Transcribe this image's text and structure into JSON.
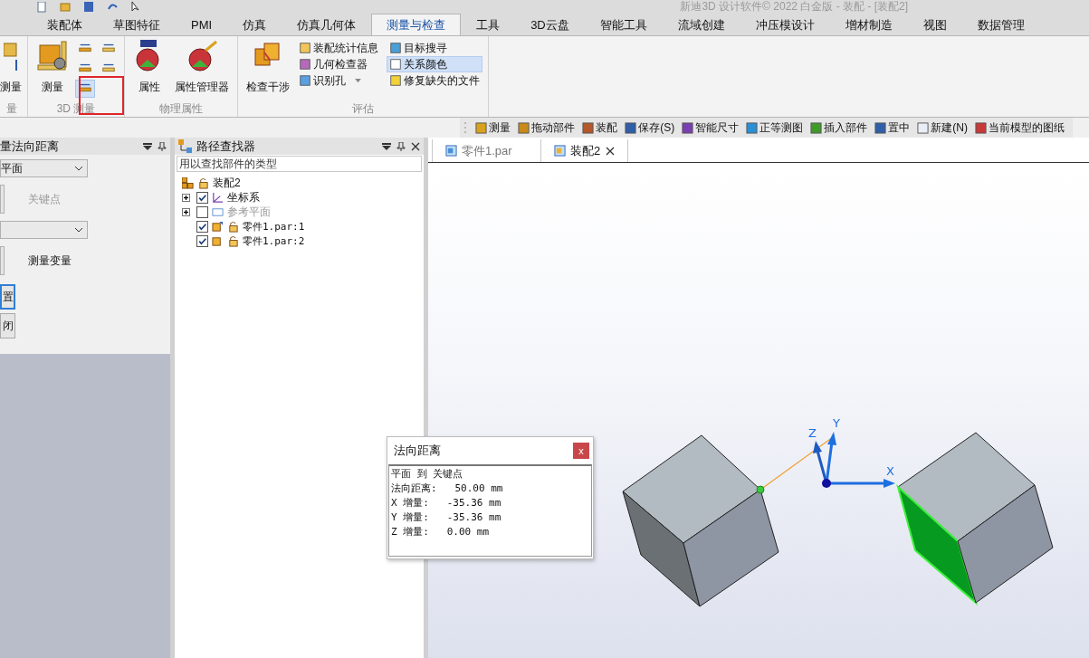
{
  "window": {
    "title": "新迪3D 设计软件© 2022 白金版 - 装配 - [装配2]"
  },
  "ribbon_tabs": [
    {
      "label": "装配体",
      "selected": false
    },
    {
      "label": "草图特征",
      "selected": false
    },
    {
      "label": "PMI",
      "selected": false
    },
    {
      "label": "仿真",
      "selected": false
    },
    {
      "label": "仿真几何体",
      "selected": false
    },
    {
      "label": "测量与检查",
      "selected": true
    },
    {
      "label": "工具",
      "selected": false
    },
    {
      "label": "3D云盘",
      "selected": false
    },
    {
      "label": "智能工具",
      "selected": false
    },
    {
      "label": "流域创建",
      "selected": false
    },
    {
      "label": "冲压模设计",
      "selected": false
    },
    {
      "label": "增材制造",
      "selected": false
    },
    {
      "label": "视图",
      "selected": false
    },
    {
      "label": "数据管理",
      "selected": false
    }
  ],
  "ribbon_groups": [
    {
      "kind": "partial",
      "label": "量",
      "buttons": [
        {
          "label": "测量"
        }
      ]
    },
    {
      "kind": "measure3d",
      "label": "3D 测量",
      "highlighted": true,
      "buttons": [
        {
          "label": "测量"
        }
      ],
      "small_tools": [
        {
          "selected": false
        },
        {
          "selected": false
        },
        {
          "selected": false
        },
        {
          "selected": false
        },
        {
          "selected": true
        }
      ]
    },
    {
      "kind": "large",
      "label": "物理属性",
      "buttons": [
        {
          "label": "属性"
        },
        {
          "label": "属性管理器"
        }
      ]
    },
    {
      "kind": "evaluate",
      "label": "评估",
      "buttons": [
        {
          "label": "检查干涉"
        }
      ],
      "list_items": [
        {
          "kind": "button",
          "label": "装配统计信息",
          "selected": false
        },
        {
          "kind": "button",
          "label": "几何检查器",
          "selected": false
        },
        {
          "kind": "dropdown",
          "label": "识别孔",
          "selected": false
        },
        {
          "kind": "button",
          "label": "目标搜寻",
          "selected": false
        },
        {
          "kind": "button",
          "label": "关系颜色",
          "selected": true
        },
        {
          "kind": "button",
          "label": "修复缺失的文件",
          "selected": false
        }
      ]
    }
  ],
  "toolbar": [
    "测量",
    "拖动部件",
    "装配",
    "保存(S)",
    "智能尺寸",
    "正等测图",
    "插入部件",
    "置中",
    "新建(N)",
    "当前模型的图纸"
  ],
  "measure_panel": {
    "title": "量法向距离",
    "dropdown_1": "平面",
    "keypoint_label": "关键点",
    "keypoint_disabled": true,
    "variable_label": "测量变量",
    "buttons": [
      {
        "label": "置",
        "focused": true
      },
      {
        "label": "闭",
        "focused": false
      }
    ]
  },
  "pathfinder": {
    "title": "路径查找器",
    "search_placeholder": "用以查找部件的类型",
    "tree": [
      {
        "label": "装配2",
        "children": [
          {
            "label": "坐标系",
            "kind": "coords",
            "checked": true,
            "expanded": false,
            "disabled": false
          },
          {
            "label": "参考平面",
            "kind": "plane",
            "checked": false,
            "expanded": false,
            "disabled": true
          },
          {
            "label": "零件1.par:1",
            "kind": "part",
            "checked": true,
            "disabled": false
          },
          {
            "label": "零件1.par:2",
            "kind": "part",
            "checked": true,
            "disabled": false
          }
        ]
      }
    ]
  },
  "document_tabs": [
    {
      "label": "零件1.par",
      "selected": false
    },
    {
      "label": "装配2",
      "selected": true
    }
  ],
  "viewport": {
    "axis_labels": [
      "X",
      "Y",
      "Z"
    ]
  },
  "result_dialog": {
    "title": "法向距离",
    "close": "x",
    "lines": [
      "平面 到 关键点",
      "法向距离:   50.00 mm",
      "X 增量:   -35.36 mm",
      "Y 增量:   -35.36 mm",
      "Z 增量:   0.00 mm"
    ]
  }
}
